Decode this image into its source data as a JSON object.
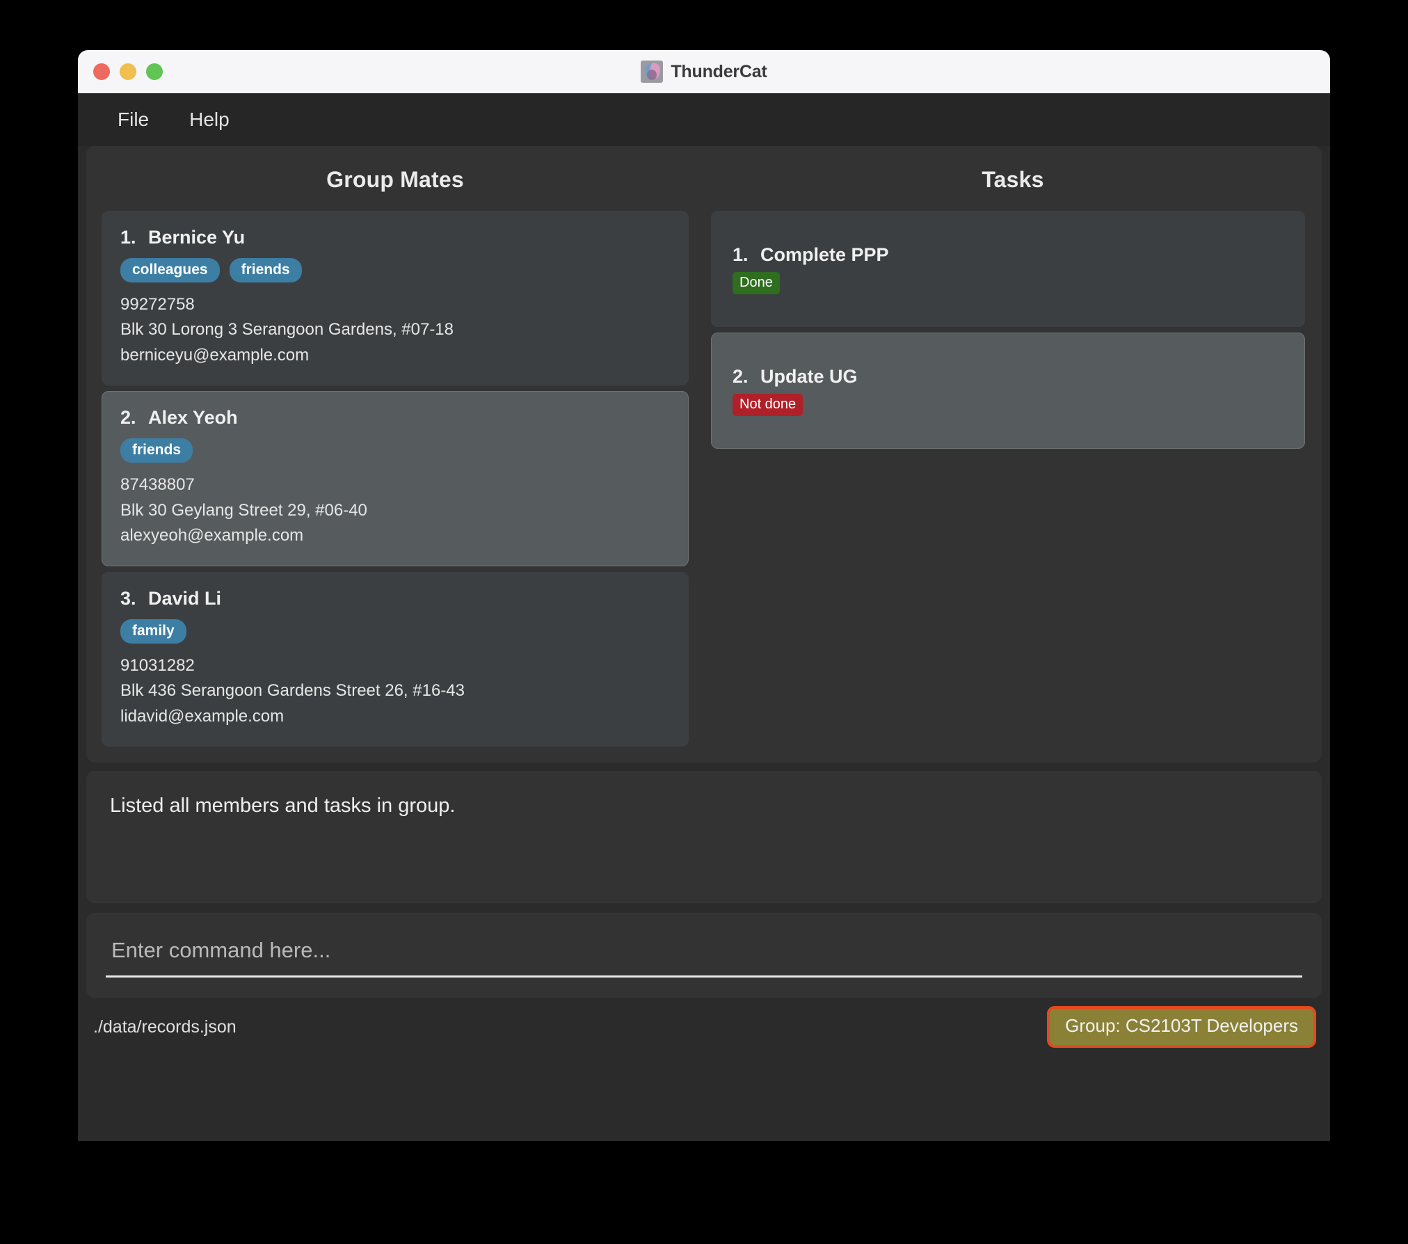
{
  "window": {
    "title": "ThunderCat",
    "icon": "thundercat-logo-icon",
    "traffic_lights": {
      "close": "close-window-button",
      "minimize": "minimize-window-button",
      "maximize": "maximize-window-button"
    }
  },
  "menubar": {
    "items": [
      {
        "label": "File"
      },
      {
        "label": "Help"
      }
    ]
  },
  "panels": {
    "mates": {
      "header": "Group Mates",
      "cards": [
        {
          "index": "1.",
          "name": "Bernice Yu",
          "tags": [
            "colleagues",
            "friends"
          ],
          "phone": "99272758",
          "address": "Blk 30 Lorong 3 Serangoon Gardens, #07-18",
          "email": "berniceyu@example.com",
          "selected": false
        },
        {
          "index": "2.",
          "name": "Alex Yeoh",
          "tags": [
            "friends"
          ],
          "phone": "87438807",
          "address": "Blk 30 Geylang Street 29, #06-40",
          "email": "alexyeoh@example.com",
          "selected": true
        },
        {
          "index": "3.",
          "name": "David Li",
          "tags": [
            "family"
          ],
          "phone": "91031282",
          "address": "Blk 436 Serangoon Gardens Street 26, #16-43",
          "email": "lidavid@example.com",
          "selected": false
        }
      ]
    },
    "tasks": {
      "header": "Tasks",
      "cards": [
        {
          "index": "1.",
          "name": "Complete PPP",
          "status": "Done",
          "status_kind": "done",
          "selected": false
        },
        {
          "index": "2.",
          "name": "Update UG",
          "status": "Not done",
          "status_kind": "notdone",
          "selected": true
        }
      ]
    }
  },
  "result": {
    "text": "Listed all members and tasks in group."
  },
  "command": {
    "value": "",
    "placeholder": "Enter command here..."
  },
  "statusbar": {
    "save_location": "./data/records.json",
    "group_label": "Group: CS2103T Developers"
  },
  "colors": {
    "window_background": "#2b2b2b",
    "panel_background": "#333333",
    "card_background": "#3c3f41",
    "card_selected_background": "#565b5e",
    "tag_background": "#3d7fa4",
    "status_done": "#2f6d1f",
    "status_not_done": "#b02028",
    "group_badge_background": "#8a8136",
    "group_badge_border": "#e34a1e",
    "titlebar_background": "#f6f5f7"
  }
}
